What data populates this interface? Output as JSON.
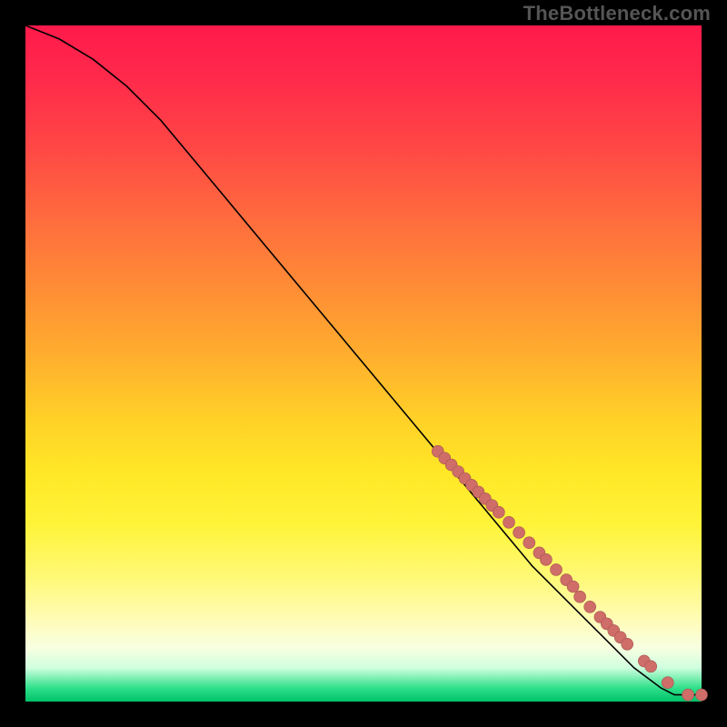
{
  "watermark": "TheBottleneck.com",
  "chart_data": {
    "type": "line",
    "title": "",
    "xlabel": "",
    "ylabel": "",
    "xlim": [
      0,
      100
    ],
    "ylim": [
      0,
      100
    ],
    "series": [
      {
        "name": "curve",
        "x": [
          0,
          5,
          10,
          15,
          20,
          25,
          30,
          35,
          40,
          45,
          50,
          55,
          60,
          65,
          70,
          75,
          80,
          85,
          90,
          94,
          96,
          98,
          100
        ],
        "y": [
          100,
          98,
          95,
          91,
          86,
          80,
          74,
          68,
          62,
          56,
          50,
          44,
          38,
          32,
          26,
          20,
          15,
          10,
          5,
          2,
          1,
          1,
          1
        ]
      }
    ],
    "markers": {
      "name": "segment-dots",
      "x": [
        61,
        62,
        63,
        64,
        65,
        66,
        67,
        68,
        69,
        70,
        71.5,
        73,
        74.5,
        76,
        77,
        78.5,
        80,
        81,
        82,
        83.5,
        85,
        86,
        87,
        88,
        89,
        91.5,
        92.5,
        95,
        98,
        100
      ],
      "y": [
        37,
        36,
        35,
        34,
        33,
        32,
        31,
        30,
        29,
        28,
        26.5,
        25,
        23.5,
        22,
        21,
        19.5,
        18,
        17,
        15.5,
        14,
        12.5,
        11.5,
        10.5,
        9.5,
        8.5,
        6,
        5.2,
        2.8,
        1,
        1
      ]
    }
  }
}
